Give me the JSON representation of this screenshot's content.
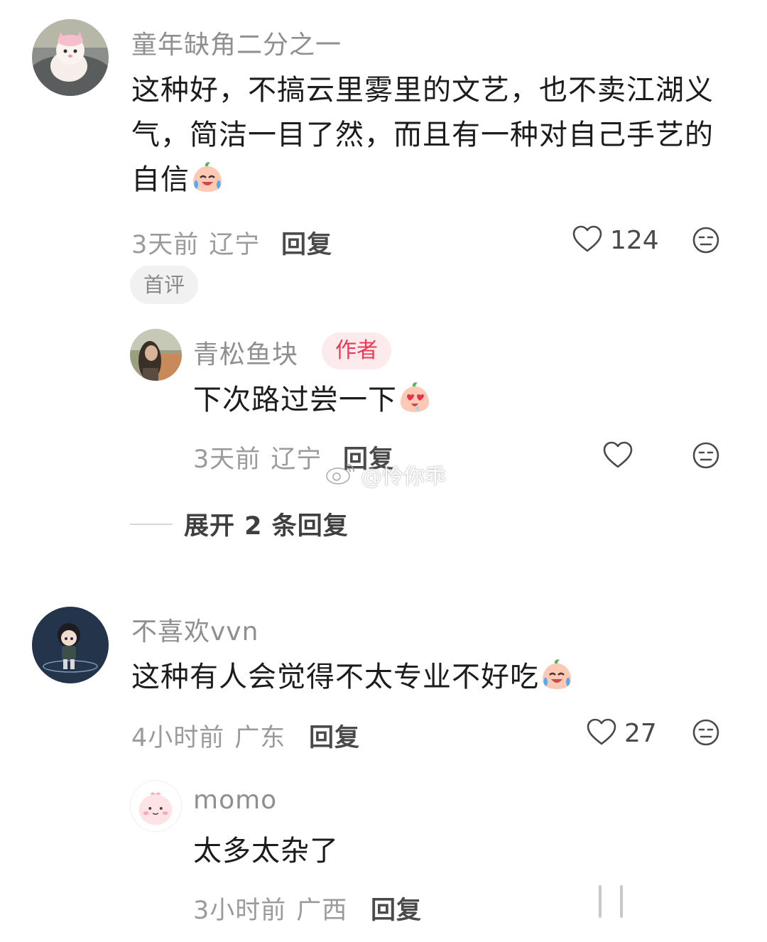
{
  "comments": [
    {
      "username": "童年缺角二分之一",
      "text": "这种好，不搞云里雾里的文艺，也不卖江湖义气，简洁一目了然，而且有一种对自己手艺的自信",
      "emoji": "crying-laugh-emoji",
      "time": "3天前",
      "location": "辽宁",
      "reply_label": "回复",
      "likes": "124",
      "badge": "首评",
      "avatar": "pink-kitten-avatar",
      "replies": [
        {
          "username": "青松鱼块",
          "author_badge": "作者",
          "text": "下次路过尝一下",
          "emoji": "heart-eyes-emoji",
          "time": "3天前",
          "location": "辽宁",
          "reply_label": "回复",
          "avatar": "photo-avatar"
        }
      ],
      "expand_label": "展开 2 条回复"
    },
    {
      "username": "不喜欢vvn",
      "text": "这种有人会觉得不太专业不好吃",
      "emoji": "crying-laugh-emoji",
      "time": "4小时前",
      "location": "广东",
      "reply_label": "回复",
      "likes": "27",
      "avatar": "anime-character-avatar",
      "replies": [
        {
          "username": "momo",
          "text": "太多太杂了",
          "time": "3小时前",
          "location": "广西",
          "reply_label": "回复",
          "avatar": "pink-blob-avatar"
        }
      ]
    }
  ],
  "watermark": "@怜你乖",
  "colors": {
    "username": "#8f8f8f",
    "meta": "#9b9b9b",
    "author_badge_text": "#e83a54",
    "author_badge_bg": "#fdeaec",
    "badge_bg": "#f1f1f1"
  }
}
